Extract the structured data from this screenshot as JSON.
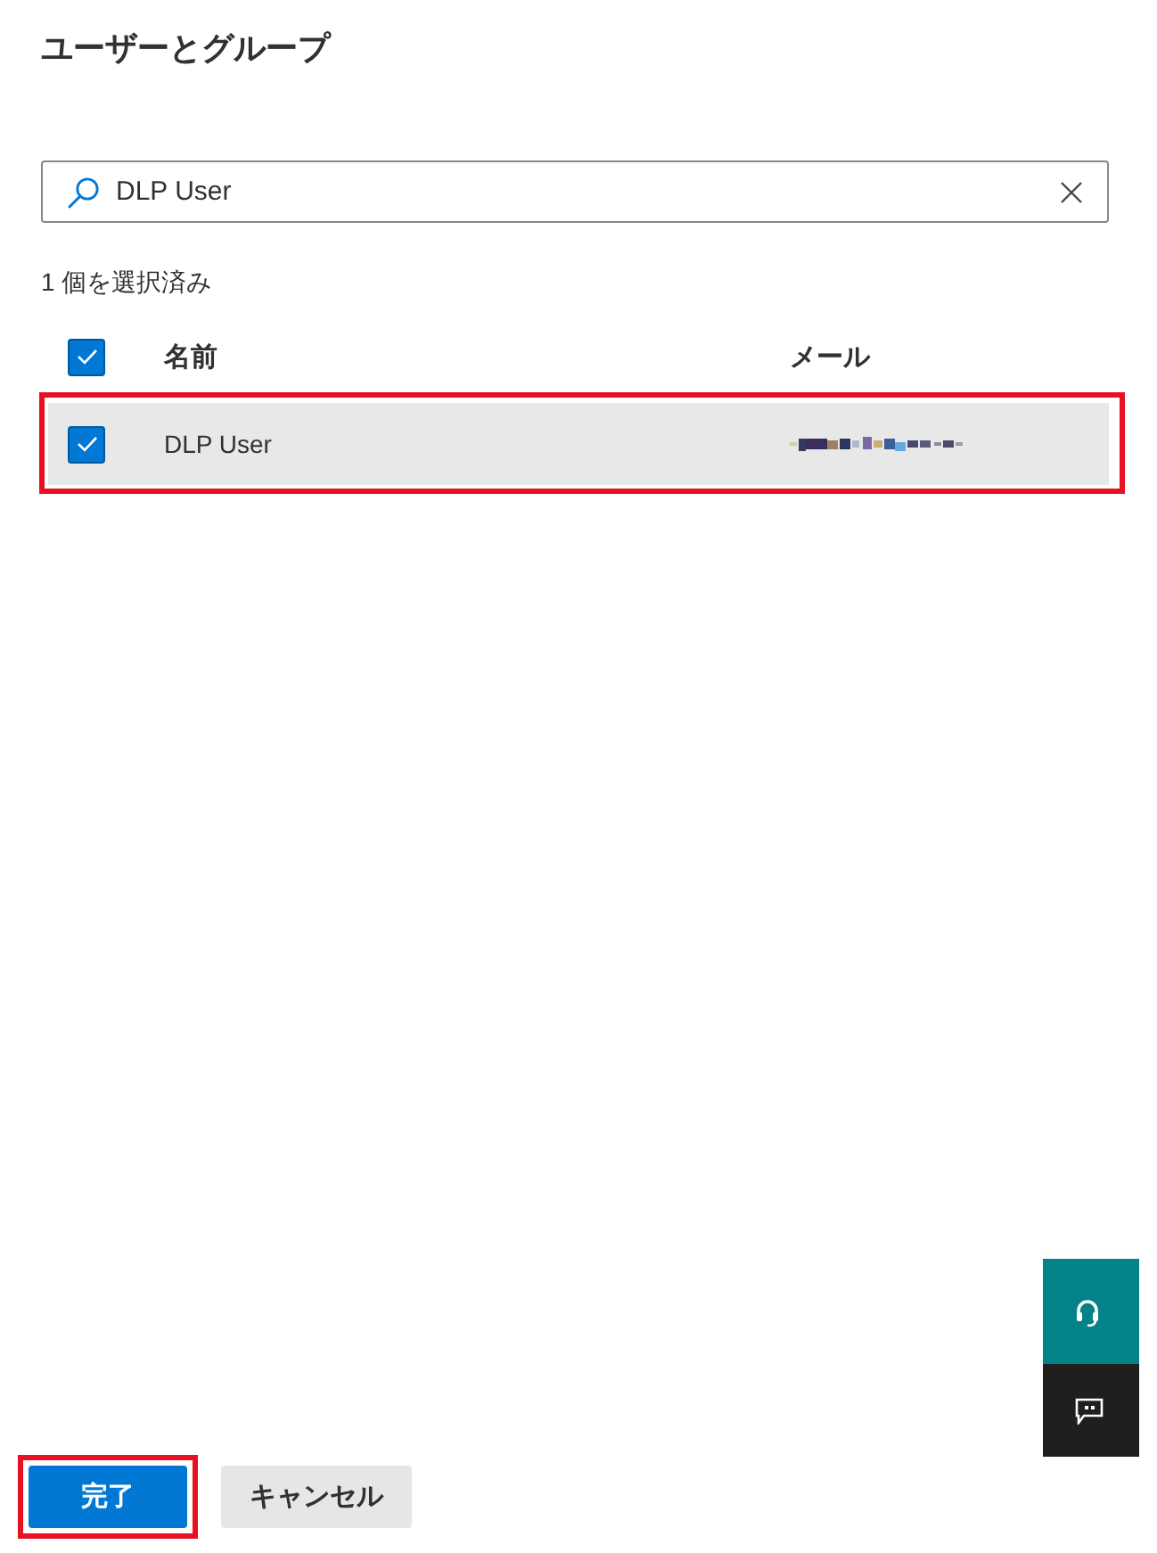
{
  "panel": {
    "title": "ユーザーとグループ"
  },
  "search": {
    "value": "DLP User"
  },
  "selection_count": "1 個を選択済み",
  "table": {
    "select_all": {
      "checked": true
    },
    "columns": [
      "名前",
      "メール"
    ],
    "rows": [
      {
        "name": "DLP User",
        "checked": true,
        "selected": true,
        "highlighted": true
      }
    ]
  },
  "side_buttons": [
    {
      "kind": "support"
    },
    {
      "kind": "feedback"
    }
  ],
  "footer": {
    "buttons": [
      {
        "label": "完了",
        "kind": "primary",
        "highlighted": true
      },
      {
        "label": "キャンセル",
        "kind": "secondary",
        "highlighted": false
      }
    ]
  }
}
